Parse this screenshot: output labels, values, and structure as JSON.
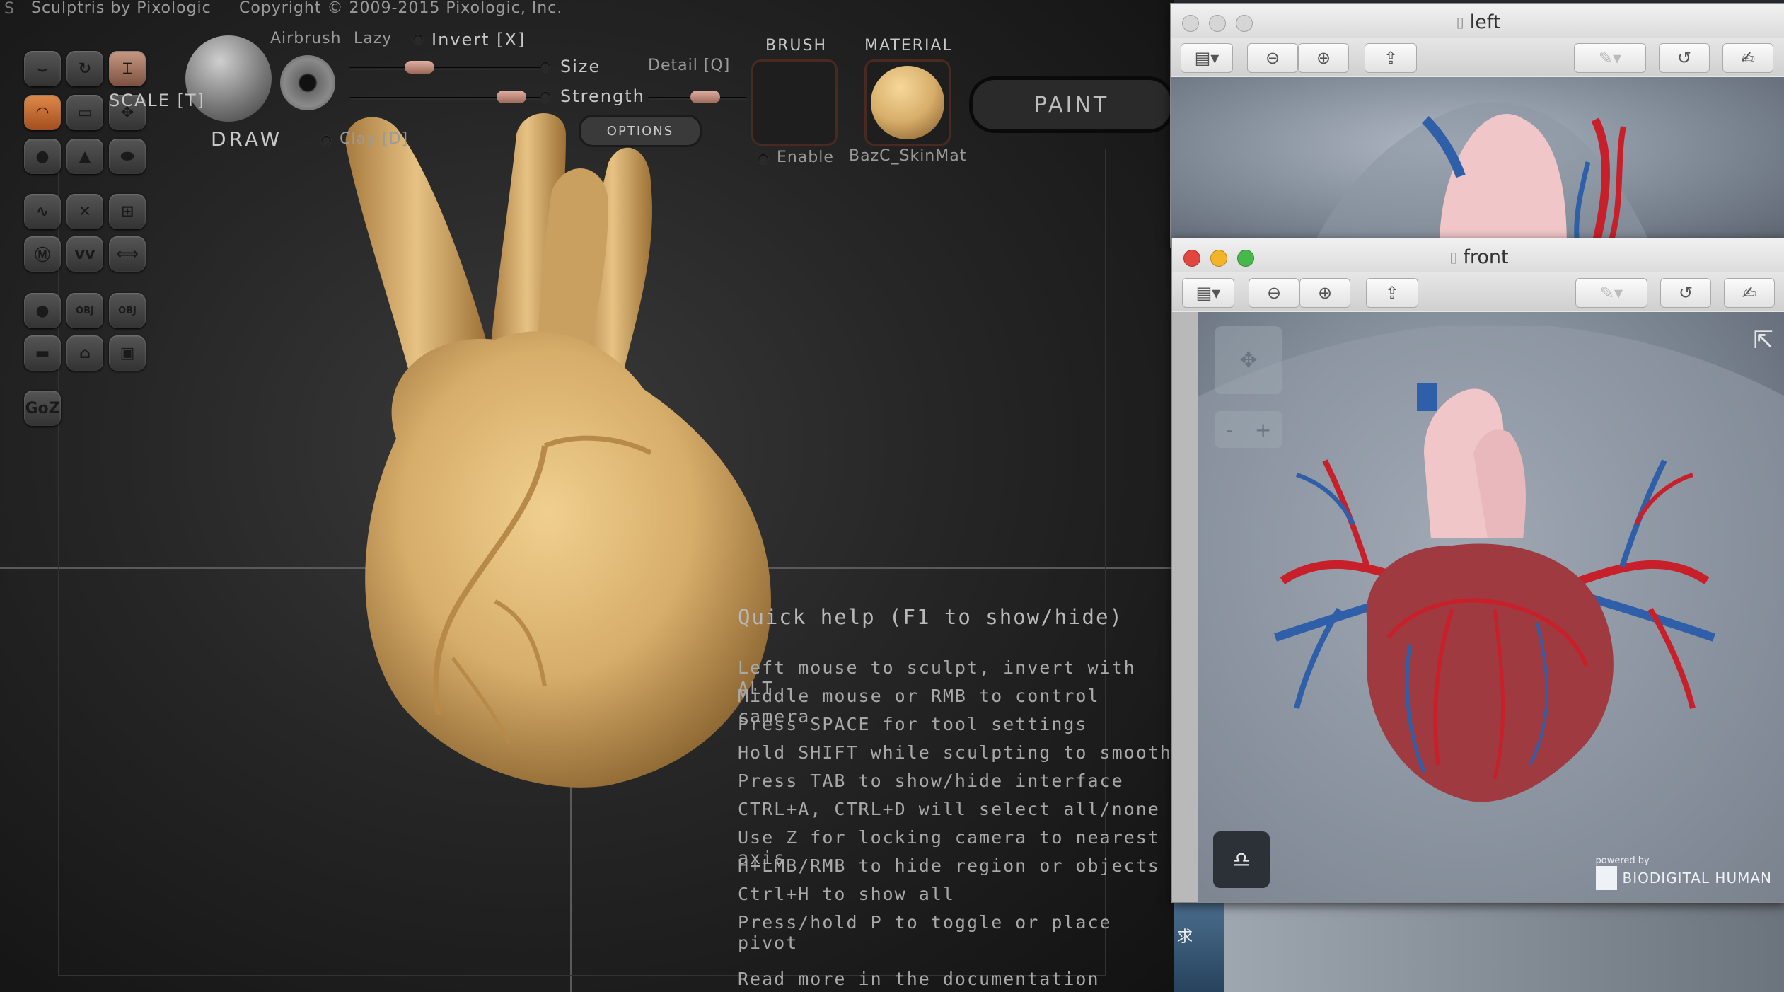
{
  "sculptris": {
    "title_logo": "S",
    "app_title": "Sculptris by Pixologic",
    "copyright": "Copyright © 2009-2015 Pixologic, Inc.",
    "scale_label": "SCALE [T]",
    "draw_label": "DRAW",
    "airbrush_label": "Airbrush",
    "lazy_label": "Lazy",
    "invert_label": "Invert [X]",
    "size_label": "Size",
    "detail_label": "Detail [Q]",
    "strength_label": "Strength",
    "clay_label": "Clay [D]",
    "options_label": "OPTIONS",
    "brush_header": "BRUSH",
    "material_header": "MATERIAL",
    "enable_label": "Enable",
    "material_name": "BazC_SkinMat",
    "paint_label": "PAINT",
    "goz_label": "GoZ",
    "obj_label": "OBJ",
    "help_title": "Quick help (F1 to show/hide)",
    "help_lines": [
      "Left mouse to sculpt, invert with ALT",
      "Middle mouse or RMB to control camera",
      "Press SPACE for tool settings",
      "Hold SHIFT while sculpting to smooth",
      "Press TAB to show/hide interface",
      "CTRL+A, CTRL+D will select all/none",
      "Use Z for locking camera to nearest axis",
      "H+LMB/RMB to hide region or objects",
      "Ctrl+H to show all",
      "Press/hold P to toggle or place pivot"
    ],
    "help_more": "Read more in the documentation"
  },
  "windows": {
    "left": {
      "title": "left"
    },
    "front": {
      "title": "front",
      "powered_by": "powered by",
      "brand": "BIODIGITAL HUMAN",
      "zoom_minus": "-",
      "zoom_plus": "+"
    }
  },
  "background_fragment": "求",
  "colors": {
    "clay": "#d7ad6a",
    "active_tool": "#d0763a",
    "artery_red": "#c8202a",
    "vein_blue": "#2f5fa8",
    "close_red": "#e2463f",
    "minimize_yellow": "#f4b42a",
    "zoom_green": "#47b84b"
  }
}
